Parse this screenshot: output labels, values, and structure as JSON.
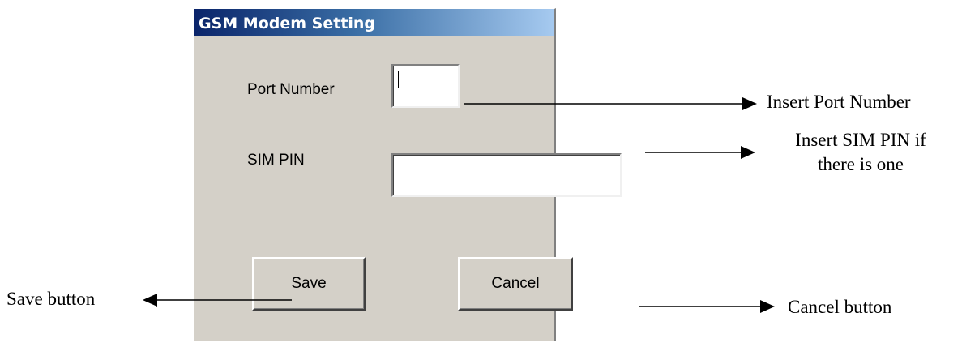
{
  "dialog": {
    "title": "GSM Modem Setting",
    "port_number_label": "Port Number",
    "port_number_value": "",
    "sim_pin_label": "SIM PIN",
    "sim_pin_value": "",
    "save_label": "Save",
    "cancel_label": "Cancel"
  },
  "annotations": {
    "port": "Insert Port Number",
    "sim_line1": "Insert SIM PIN if",
    "sim_line2": "there is one",
    "save": "Save button",
    "cancel": "Cancel button"
  }
}
